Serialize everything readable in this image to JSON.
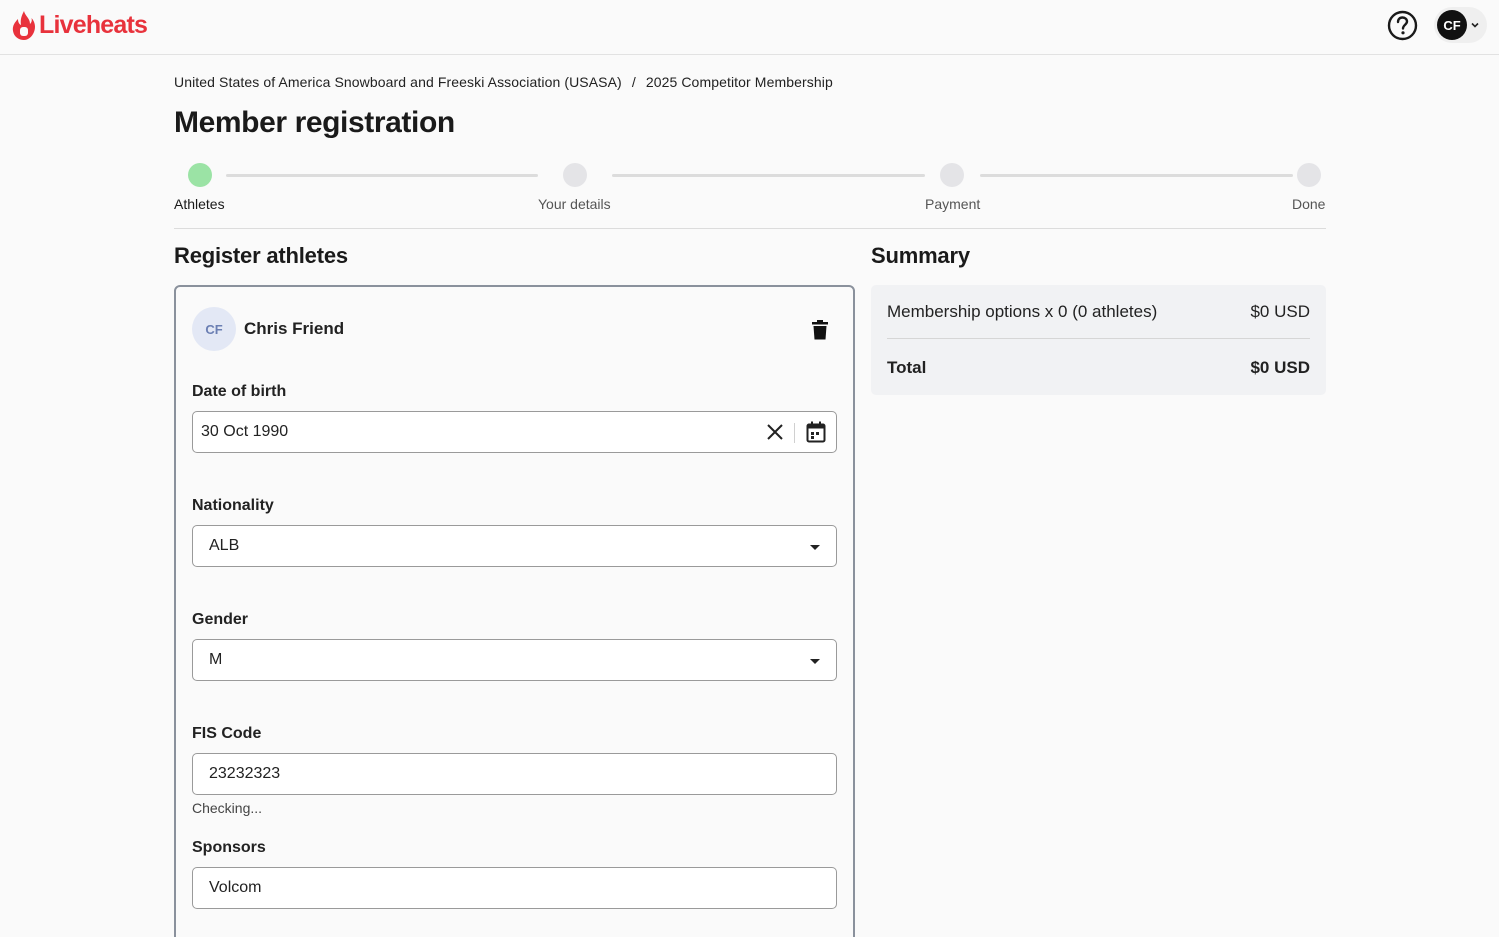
{
  "header": {
    "logo_text": "Liveheats",
    "user_initials": "CF"
  },
  "breadcrumb": {
    "org": "United States of America Snowboard and Freeski Association (USASA)",
    "separator": "/",
    "current": "2025 Competitor Membership"
  },
  "page_title": "Member registration",
  "stepper": {
    "steps": [
      {
        "label": "Athletes",
        "state": "active"
      },
      {
        "label": "Your details",
        "state": "pending"
      },
      {
        "label": "Payment",
        "state": "pending"
      },
      {
        "label": "Done",
        "state": "pending"
      }
    ]
  },
  "register": {
    "title": "Register athletes",
    "athlete": {
      "initials": "CF",
      "name": "Chris Friend"
    },
    "fields": {
      "dob": {
        "label": "Date of birth",
        "value": "30 Oct 1990"
      },
      "nationality": {
        "label": "Nationality",
        "value": "ALB"
      },
      "gender": {
        "label": "Gender",
        "value": "M"
      },
      "fis_code": {
        "label": "FIS Code",
        "value": "23232323",
        "helper": "Checking..."
      },
      "sponsors": {
        "label": "Sponsors",
        "value": "Volcom"
      }
    }
  },
  "summary": {
    "title": "Summary",
    "line_label": "Membership options x 0 (0 athletes)",
    "line_amount": "$0 USD",
    "total_label": "Total",
    "total_amount": "$0 USD"
  },
  "colors": {
    "brand": "#e8323c",
    "step_active": "#9be3a5",
    "step_pending": "#e4e4e7"
  }
}
